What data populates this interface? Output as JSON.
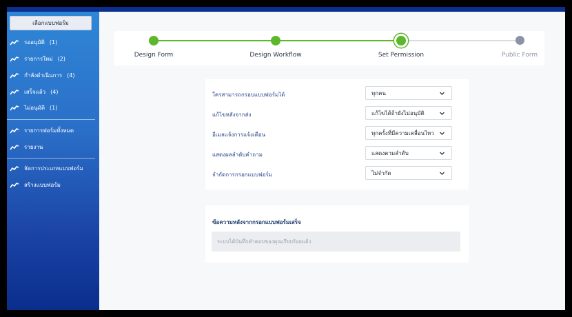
{
  "sidebar": {
    "select_form_button": "เลือกแบบฟอร์ม",
    "items": [
      {
        "label": "รออนุมัติ",
        "count": "(1)"
      },
      {
        "label": "รายการใหม่",
        "count": "(2)"
      },
      {
        "label": "กำลังดำเนินการ",
        "count": "(4)"
      },
      {
        "label": "เสร็จแล้ว",
        "count": "(4)"
      },
      {
        "label": "ไม่อนุมัติ",
        "count": "(1)"
      },
      {
        "label": "รายการฟอร์มทั้งหมด"
      },
      {
        "label": "รายงาน"
      },
      {
        "label": "จัดการประเภทแบบฟอร์ม"
      },
      {
        "label": "สร้างแบบฟอร์ม"
      }
    ]
  },
  "steps": [
    {
      "label": "Design Form",
      "state": "done"
    },
    {
      "label": "Design Workflow",
      "state": "done"
    },
    {
      "label": "Set Permission",
      "state": "current"
    },
    {
      "label": "Public Form",
      "state": "pending"
    }
  ],
  "permissions": [
    {
      "label": "ใครสามารถกรอบแบบฟอร์มได้",
      "value": "ทุกคน"
    },
    {
      "label": "แก้ไขหลังจากส่ง",
      "value": "แก้ไขได้ถ้ายังไม่อนุมัติ"
    },
    {
      "label": "อีเมลแจ้งการแจ้งเตือน",
      "value": "ทุกครั้งที่มีความเคลื่อนไหว"
    },
    {
      "label": "แสดงผลลำดับคำถาม",
      "value": "แสดงตามลำดับ"
    },
    {
      "label": "จำกัดการกรอกแบบฟอร์ม",
      "value": "ไม่จำกัด"
    }
  ],
  "after_submit": {
    "title": "ข้อความหลังจากกรอกแบบฟอร์มเสร็จ",
    "placeholder": "ระบบได้บันทึกคำตอบของคุณเรียบร้อยแล้ว"
  },
  "colors": {
    "sidebar_top": "#2f86d6",
    "sidebar_bottom": "#0a2e8c",
    "step_done": "#5cb82a",
    "step_pending": "#8a94a6"
  }
}
